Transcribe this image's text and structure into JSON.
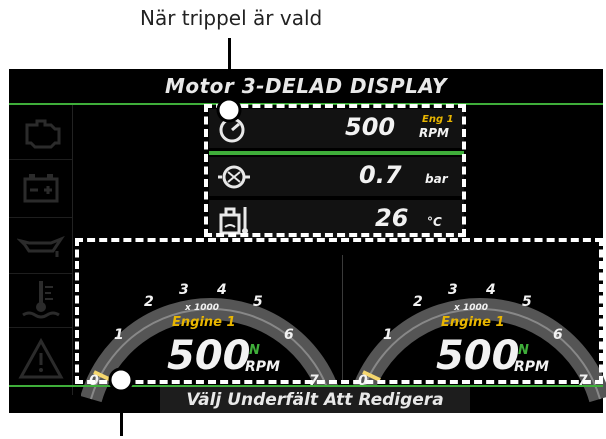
{
  "callout_top": "När trippel är vald",
  "display": {
    "title": "Motor 3-DELAD DISPLAY",
    "footer": "Välj Underfält Att Redigera"
  },
  "sidebar": {
    "icons": [
      "engine-icon",
      "battery-icon",
      "oil-can-icon",
      "coolant-temp-icon",
      "warning-triangle-icon"
    ]
  },
  "rows": [
    {
      "icon": "tachometer-icon",
      "value": "500",
      "label_top": "Eng 1",
      "unit": "RPM"
    },
    {
      "icon": "turbo-icon",
      "value": "0.7",
      "unit": "bar"
    },
    {
      "icon": "oil-temp-icon",
      "value": "26",
      "unit": "°C"
    }
  ],
  "gauges": [
    {
      "ticks": [
        "0",
        "1",
        "2",
        "3",
        "4",
        "5",
        "6",
        "7"
      ],
      "multiplier": "x 1000",
      "engine": "Engine 1",
      "value": "500",
      "indicator": "N",
      "unit": "RPM"
    },
    {
      "ticks": [
        "0",
        "1",
        "2",
        "3",
        "4",
        "5",
        "6",
        "7"
      ],
      "multiplier": "x 1000",
      "engine": "Engine 1",
      "value": "500",
      "indicator": "N",
      "unit": "RPM"
    }
  ],
  "colors": {
    "accent_green": "#3fae3a",
    "label_yellow": "#e9b600",
    "needle": "#f5d76e"
  }
}
